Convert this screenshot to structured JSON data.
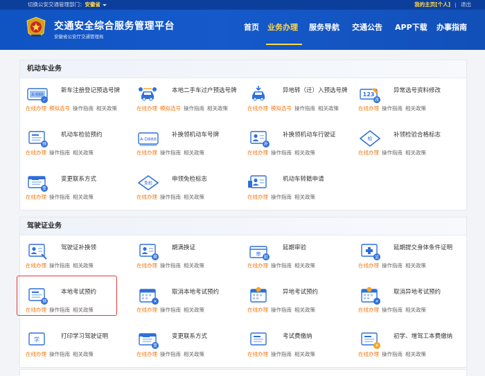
{
  "topbar": {
    "dept_prefix": "切换公安交通管理部门：",
    "dept_name": "安徽省",
    "home_link": "我的主页[个人]",
    "logout_link": "退出"
  },
  "header": {
    "title": "交通安全综合服务管理平台",
    "subtitle": "安徽省公安厅交通管理局"
  },
  "nav": {
    "items": [
      {
        "label": "首页"
      },
      {
        "label": "业务办理"
      },
      {
        "label": "服务导航"
      },
      {
        "label": "交通公告"
      },
      {
        "label": "APP下载"
      },
      {
        "label": "办事指南"
      }
    ],
    "active_index": 1
  },
  "link_labels": {
    "online": "在线办理",
    "mock": "模拟选号",
    "guide": "操作指南",
    "policy": "相关政策"
  },
  "colors": {
    "header_blue": "#1559cb",
    "accent_yellow": "#ffd84a",
    "link_orange": "#f07a16",
    "icon_blue": "#2f6fd9",
    "highlight_red": "#e53935"
  },
  "sections": [
    {
      "title": "机动车业务",
      "items": [
        {
          "name": "新车注册登记预选号牌",
          "icon": "plate-select-icon",
          "mock": true
        },
        {
          "name": "本地二手车过户预选号牌",
          "icon": "car-transfer-icon",
          "mock": true
        },
        {
          "name": "异地转（迁）入预选号牌",
          "icon": "car-move-in-icon",
          "mock": true
        },
        {
          "name": "异常选号资料修改",
          "icon": "number-edit-icon",
          "mock": false
        },
        {
          "name": "机动车检验预约",
          "icon": "inspection-booking-icon",
          "mock": false
        },
        {
          "name": "补换领机动车号牌",
          "icon": "plate-replace-icon",
          "mock": false
        },
        {
          "name": "补换领机动车行驶证",
          "icon": "license-replace-icon",
          "mock": false
        },
        {
          "name": "补领检验合格标志",
          "icon": "inspection-mark-icon",
          "mock": false
        },
        {
          "name": "变更联系方式",
          "icon": "contact-change-icon",
          "mock": false
        },
        {
          "name": "申领免检标志",
          "icon": "exempt-mark-icon",
          "mock": false
        },
        {
          "name": "机动车转籍申请",
          "icon": "transfer-apply-icon",
          "mock": false
        }
      ]
    },
    {
      "title": "驾驶证业务",
      "items": [
        {
          "name": "驾驶证补换领",
          "icon": "driver-license-icon",
          "mock": false
        },
        {
          "name": "期满换证",
          "icon": "license-renew-icon",
          "mock": false
        },
        {
          "name": "延期审验",
          "icon": "delay-review-icon",
          "mock": false
        },
        {
          "name": "延期提交身体条件证明",
          "icon": "health-proof-icon",
          "mock": false
        },
        {
          "name": "本地考试预约",
          "icon": "exam-booking-icon",
          "mock": false
        },
        {
          "name": "取消本地考试预约",
          "icon": "exam-cancel-icon",
          "mock": false
        },
        {
          "name": "异地考试预约",
          "icon": "remote-exam-icon",
          "mock": false
        },
        {
          "name": "取消异地考试预约",
          "icon": "remote-exam-cancel-icon",
          "mock": false
        },
        {
          "name": "打印学习驾驶证明",
          "icon": "print-proof-icon",
          "mock": false
        },
        {
          "name": "变更联系方式",
          "icon": "contact-change-icon",
          "mock": false
        },
        {
          "name": "考试费缴纳",
          "icon": "exam-fee-icon",
          "mock": false
        },
        {
          "name": "初学、增驾工本费缴纳",
          "icon": "fee-payment-icon",
          "mock": false
        }
      ]
    }
  ]
}
